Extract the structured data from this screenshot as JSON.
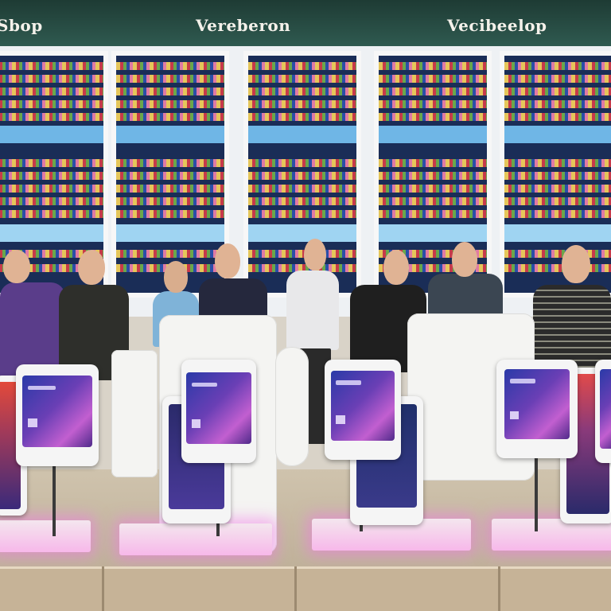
{
  "scene": {
    "description_free": true,
    "signs": [
      {
        "text": "Sbop"
      },
      {
        "text": "Vereberon"
      },
      {
        "text": "Vecibeelop"
      }
    ],
    "colors": {
      "header": "#2f5a50",
      "shelf_bg": "#1a2d57",
      "kiosk_screen": "#6a3fb5",
      "base_glow": "#f7b8ea"
    }
  }
}
